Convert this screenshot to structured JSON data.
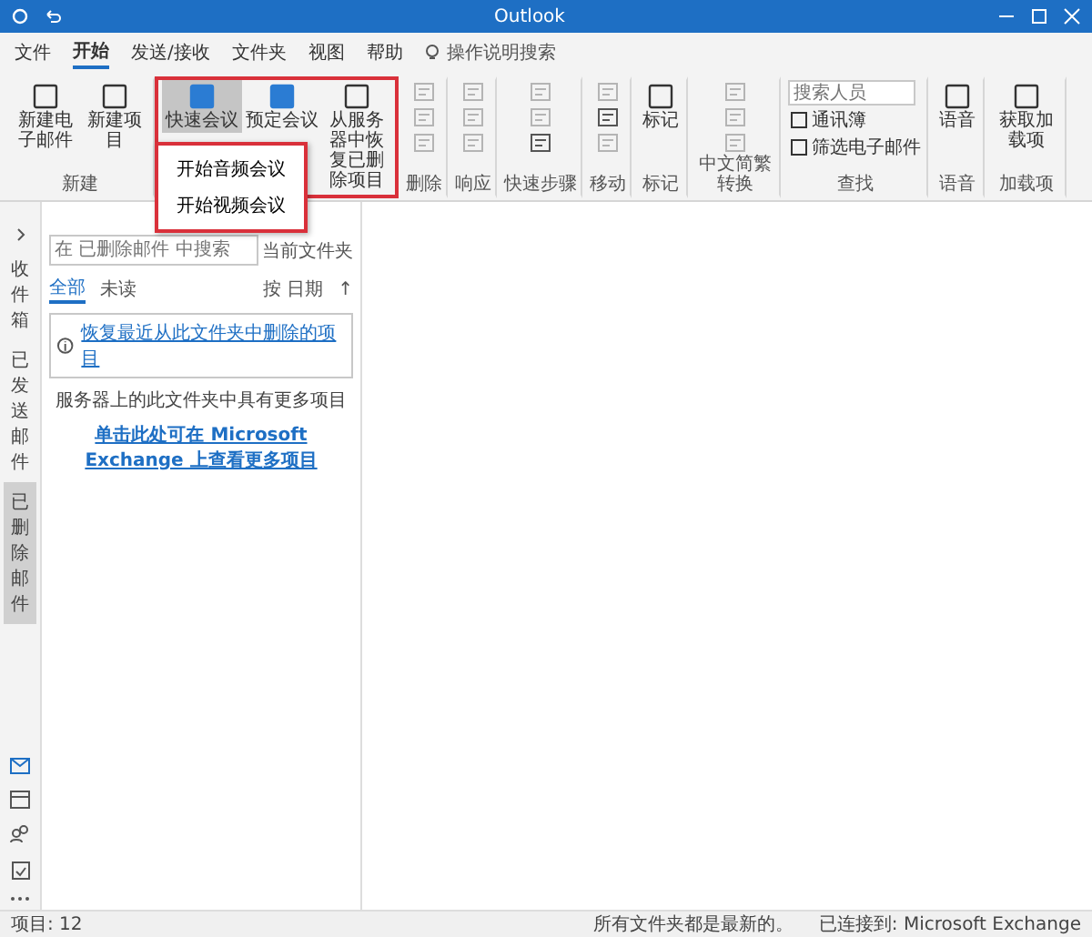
{
  "window": {
    "title": "Outlook"
  },
  "menu": [
    {
      "label": "文件",
      "selected": false
    },
    {
      "label": "开始",
      "selected": true
    },
    {
      "label": "发送/接收",
      "selected": false
    },
    {
      "label": "文件夹",
      "selected": false
    },
    {
      "label": "视图",
      "selected": false
    },
    {
      "label": "帮助",
      "selected": false
    }
  ],
  "tell_me": {
    "placeholder": "操作说明搜索"
  },
  "ribbon": {
    "groups": [
      {
        "label": "新建",
        "highlighted": false,
        "buttons": [
          {
            "kind": "large",
            "label": "新建电子邮件",
            "disabled": false
          },
          {
            "kind": "large",
            "label": "新建项目",
            "disabled": false
          }
        ]
      },
      {
        "highlighted": true,
        "buttons": [
          {
            "kind": "large",
            "label": "快速会议",
            "disabled": false,
            "selected": true
          },
          {
            "kind": "large",
            "label": "预定会议",
            "disabled": false,
            "selected": false
          },
          {
            "kind": "large",
            "label": "从服务器中恢复已删除项目",
            "disabled": false,
            "selected": false
          }
        ]
      },
      {
        "label": "删除",
        "highlighted": false,
        "buttons": [
          {
            "kind": "icon",
            "disabled": true
          },
          {
            "kind": "icon",
            "disabled": true
          },
          {
            "kind": "icon",
            "disabled": true
          }
        ]
      },
      {
        "label": "响应",
        "highlighted": false,
        "buttons": [
          {
            "kind": "icon",
            "disabled": true
          },
          {
            "kind": "icon",
            "disabled": true
          },
          {
            "kind": "icon",
            "disabled": true
          }
        ]
      },
      {
        "label": "快速步骤",
        "highlighted": false,
        "buttons": [
          {
            "kind": "icon",
            "disabled": true
          },
          {
            "kind": "icon",
            "disabled": true
          },
          {
            "kind": "icon",
            "disabled": false
          }
        ]
      },
      {
        "label": "移动",
        "highlighted": false,
        "buttons": [
          {
            "kind": "icon",
            "disabled": true
          },
          {
            "kind": "icon",
            "disabled": false
          },
          {
            "kind": "icon",
            "disabled": true
          }
        ]
      },
      {
        "label": "标记",
        "highlighted": false,
        "buttons": [
          {
            "kind": "large",
            "label": "标记",
            "disabled": false
          }
        ]
      },
      {
        "label": "中文简繁转换",
        "highlighted": false,
        "buttons": [
          {
            "kind": "icon",
            "disabled": true
          },
          {
            "kind": "icon",
            "disabled": true
          },
          {
            "kind": "icon",
            "disabled": true
          }
        ]
      },
      {
        "label": "查找",
        "highlighted": false,
        "buttons": [
          {
            "kind": "field",
            "placeholder": "搜索人员",
            "disabled": false
          },
          {
            "kind": "small",
            "label": "通讯簿",
            "disabled": false
          },
          {
            "kind": "small",
            "label": "筛选电子邮件",
            "disabled": false
          }
        ]
      },
      {
        "label": "语音",
        "highlighted": false,
        "buttons": [
          {
            "kind": "large",
            "label": "语音",
            "disabled": false
          }
        ]
      },
      {
        "label": "加载项",
        "highlighted": false,
        "buttons": [
          {
            "kind": "large",
            "label": "获取加载项",
            "disabled": false
          }
        ]
      }
    ]
  },
  "dropdown": {
    "items": [
      "开始音频会议",
      "开始视频会议"
    ]
  },
  "folder_tabs": [
    {
      "label": "收件箱",
      "selected": false
    },
    {
      "label": "已发送邮件",
      "selected": false
    },
    {
      "label": "已删除邮件",
      "selected": true
    }
  ],
  "folder_pane": {
    "search": {
      "placeholder": "在 已删除邮件 中搜索",
      "scope": "当前文件夹"
    },
    "filters": [
      {
        "label": "全部",
        "selected": true
      },
      {
        "label": "未读",
        "selected": false
      }
    ],
    "sort": "按 日期",
    "sort_direction": "↑",
    "info_link": "恢复最近从此文件夹中删除的项目",
    "message": "服务器上的此文件夹中具有更多项目",
    "more_link": "单击此处可在 Microsoft Exchange 上查看更多项目"
  },
  "status_bar": {
    "items": "项目: 12",
    "sync": "所有文件夹都是最新的。",
    "connection": "已连接到: Microsoft Exchange"
  }
}
